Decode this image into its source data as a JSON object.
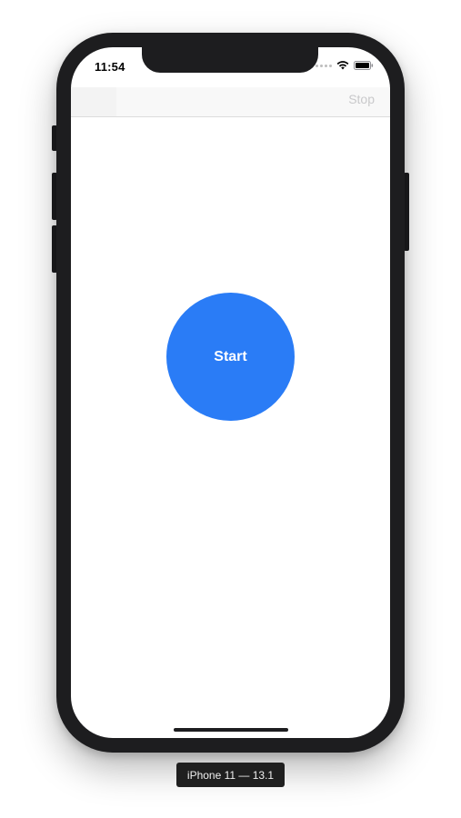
{
  "status_bar": {
    "time": "11:54",
    "icons": [
      "cellular-signal-icon",
      "wifi-icon",
      "battery-icon"
    ]
  },
  "nav_bar": {
    "stop_label": "Stop"
  },
  "main": {
    "start_label": "Start"
  },
  "simulator": {
    "device_label": "iPhone 11 — 13.1"
  },
  "colors": {
    "start_button": "#2a7cf6",
    "stop_text": "#c9c9cb",
    "device_frame": "#1d1d1f"
  }
}
